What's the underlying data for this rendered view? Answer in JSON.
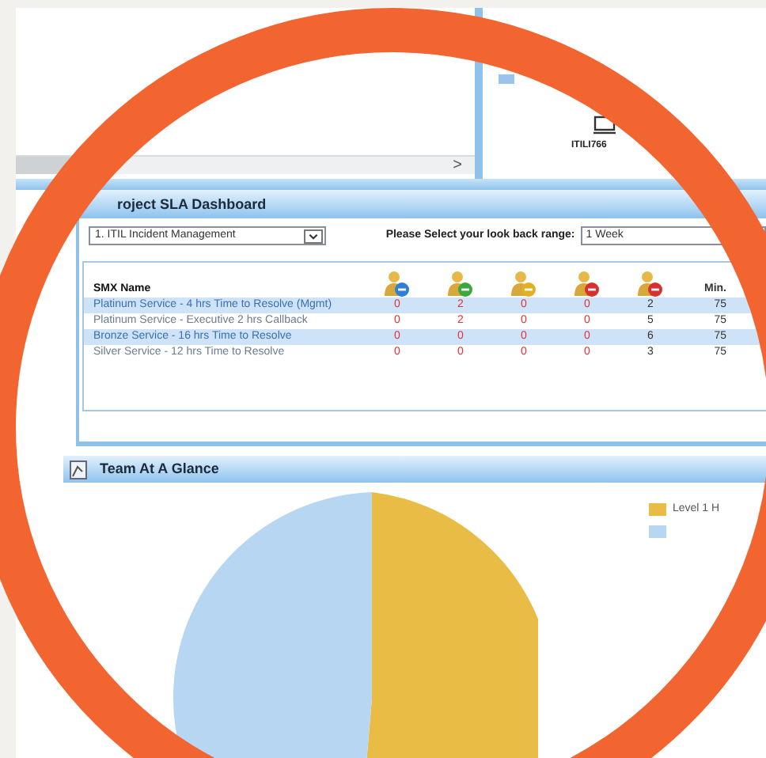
{
  "top_panel": {
    "scroll_right": ">",
    "node_label": "ITILI766"
  },
  "sla_dashboard": {
    "title": "roject SLA Dashboard",
    "process_select": {
      "value": "1. ITIL Incident Management"
    },
    "range_label": "Please Select your look back range:",
    "range_field": {
      "value": "1 Week"
    },
    "columns": [
      {
        "kind": "text",
        "label": "SMX Name"
      },
      {
        "kind": "icon",
        "color": "#2f7fd8"
      },
      {
        "kind": "icon",
        "color": "#3aa83a"
      },
      {
        "kind": "icon",
        "color": "#e2b020"
      },
      {
        "kind": "icon",
        "color": "#d83030"
      },
      {
        "kind": "icon",
        "color": "#d83030"
      },
      {
        "kind": "text",
        "label": "Min."
      }
    ],
    "rows": [
      {
        "name": "Platinum Service - 4 hrs Time to Resolve (Mgmt)",
        "values": [
          "0",
          "2",
          "0",
          "0",
          "2",
          "75"
        ]
      },
      {
        "name": "Platinum Service - Executive 2 hrs Callback",
        "values": [
          "0",
          "2",
          "0",
          "0",
          "5",
          "75"
        ]
      },
      {
        "name": "Bronze Service - 16 hrs Time to Resolve",
        "values": [
          "0",
          "0",
          "0",
          "0",
          "6",
          "75"
        ]
      },
      {
        "name": "Silver Service - 12 hrs Time to Resolve",
        "values": [
          "0",
          "0",
          "0",
          "0",
          "3",
          "75"
        ]
      }
    ]
  },
  "team_at_a_glance": {
    "title": "Team At A Glance",
    "legend": [
      {
        "label": "Level 1 H",
        "color": "#e9bd45"
      },
      {
        "color": "#b7d6f2"
      }
    ]
  }
}
